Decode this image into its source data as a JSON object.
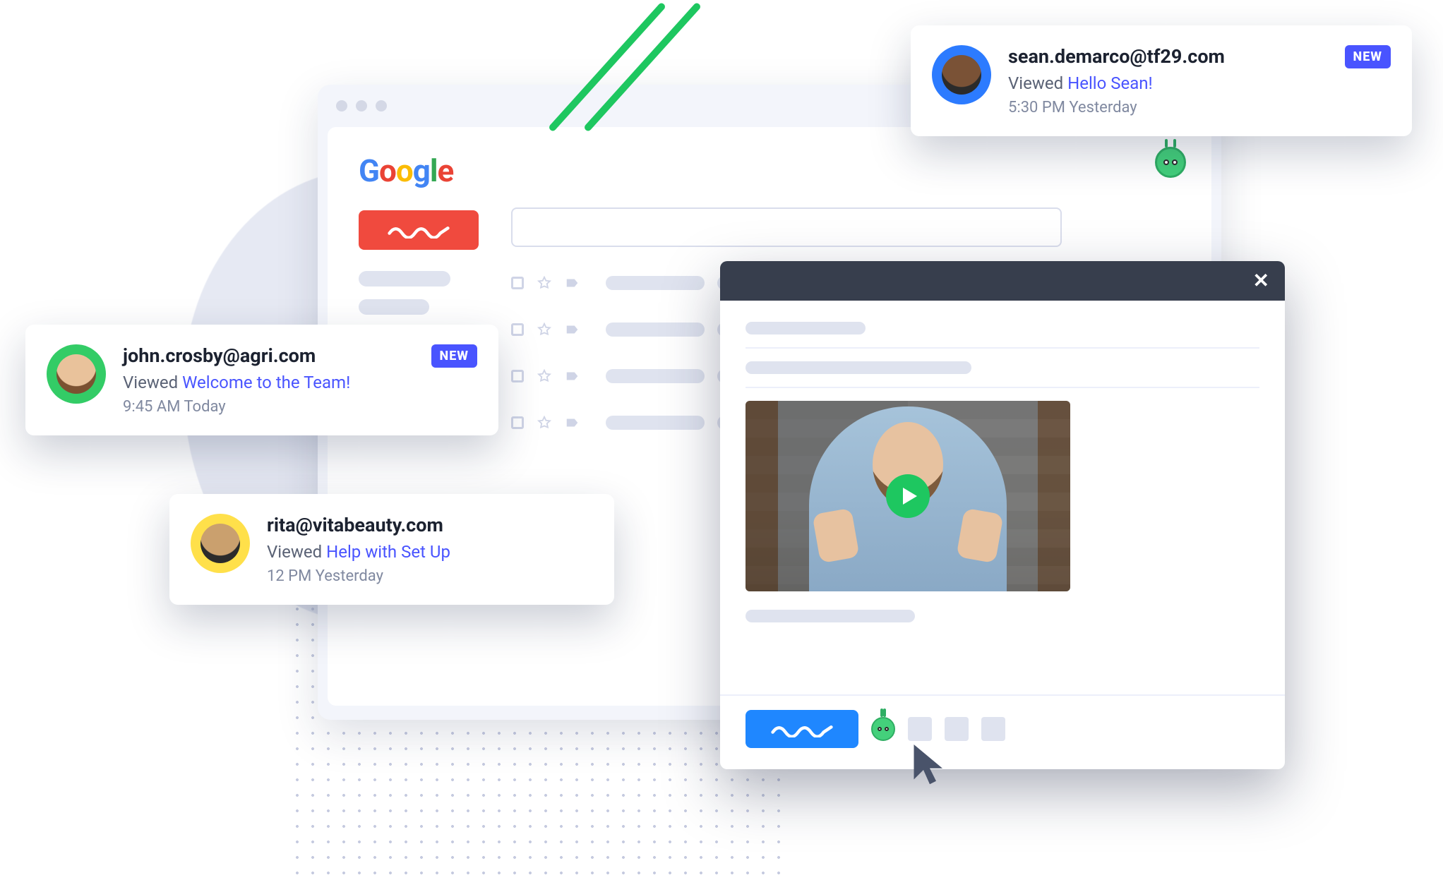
{
  "browser": {
    "logo_text": "Google"
  },
  "notifications": [
    {
      "email": "john.crosby@agri.com",
      "action": "Viewed",
      "subject": "Welcome to the Team!",
      "time": "9:45 AM Today",
      "badge": "NEW"
    },
    {
      "email": "rita@vitabeauty.com",
      "action": "Viewed",
      "subject": "Help with Set Up",
      "time": "12 PM Yesterday",
      "badge": ""
    },
    {
      "email": "sean.demarco@tf29.com",
      "action": "Viewed",
      "subject": "Hello Sean!",
      "time": "5:30 PM Yesterday",
      "badge": "NEW"
    }
  ],
  "colors": {
    "accent_green": "#1ec760",
    "accent_blue": "#1f87ff",
    "link_purple": "#4954ff",
    "compose_red": "#f04a3e"
  }
}
